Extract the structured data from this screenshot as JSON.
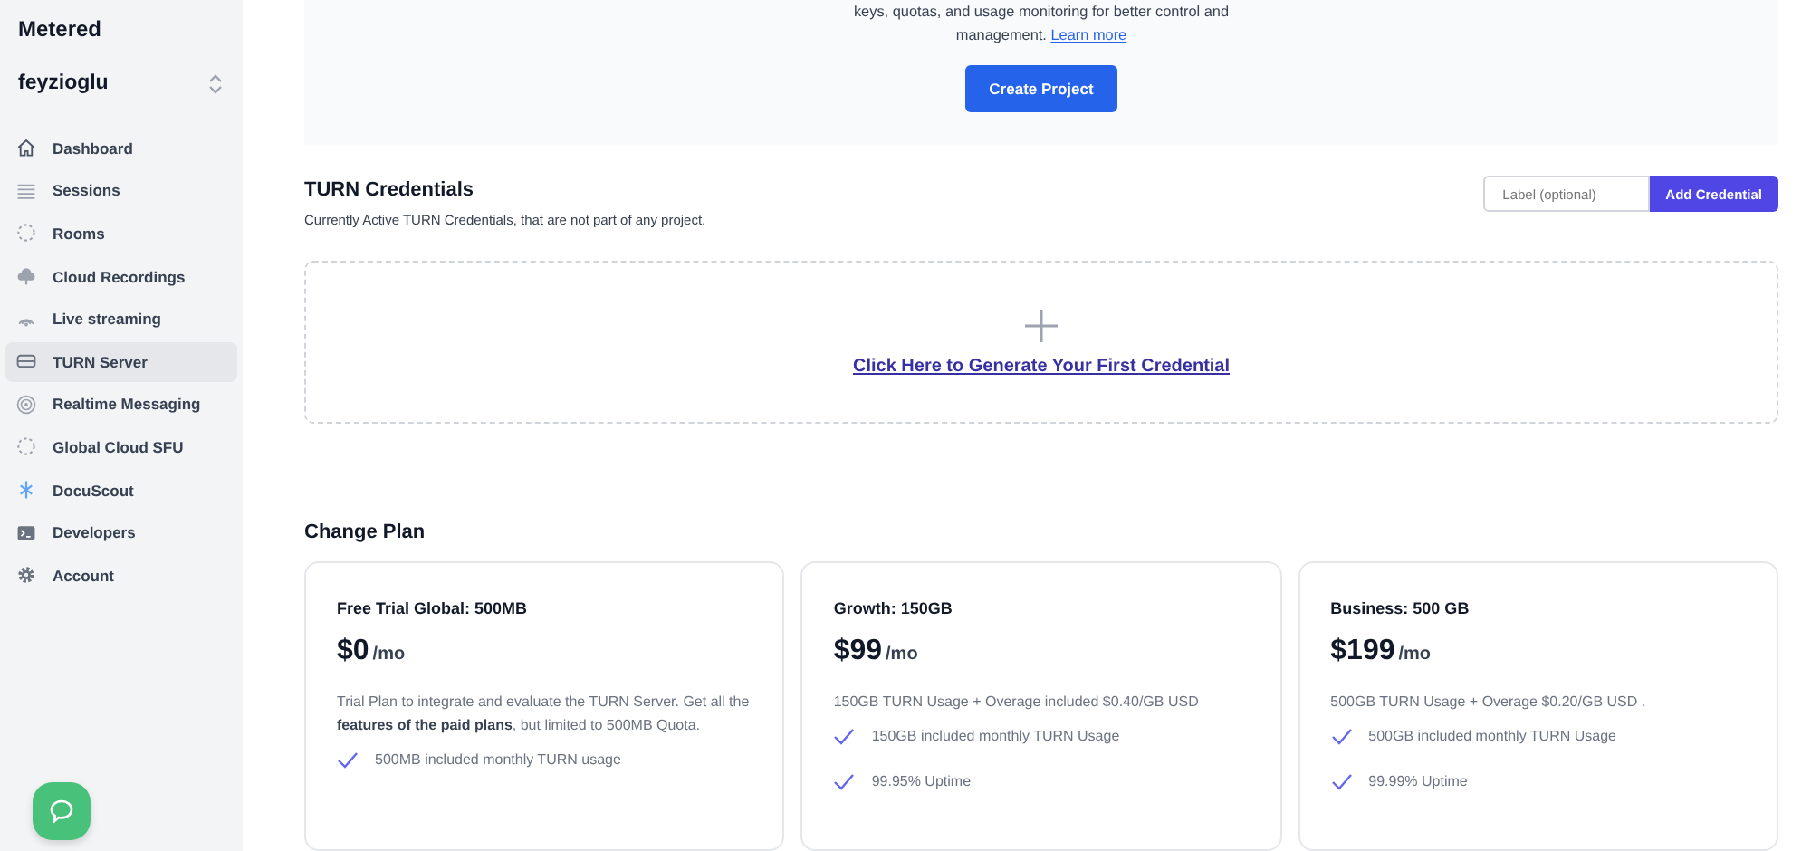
{
  "sidebar": {
    "brand": "Metered",
    "account": "feyzioglu",
    "items": [
      {
        "label": "Dashboard",
        "kind": "home",
        "selected": false
      },
      {
        "label": "Sessions",
        "kind": "list",
        "selected": false
      },
      {
        "label": "Rooms",
        "kind": "dots",
        "selected": false
      },
      {
        "label": "Cloud Recordings",
        "kind": "cloud",
        "selected": false
      },
      {
        "label": "Live streaming",
        "kind": "signal",
        "selected": false
      },
      {
        "label": "TURN Server",
        "kind": "server",
        "selected": true
      },
      {
        "label": "Realtime Messaging",
        "kind": "target",
        "selected": false
      },
      {
        "label": "Global Cloud SFU",
        "kind": "dots",
        "selected": false
      },
      {
        "label": "DocuScout",
        "kind": "tree",
        "selected": false
      },
      {
        "label": "Developers",
        "kind": "terminal",
        "selected": false
      },
      {
        "label": "Account",
        "kind": "gear",
        "selected": false
      }
    ]
  },
  "project_panel": {
    "text": "keys, quotas, and usage monitoring for better control and management.",
    "link": "Learn more",
    "button": "Create Project"
  },
  "credentials": {
    "title": "TURN Credentials",
    "subtitle": "Currently Active TURN Credentials, that are not part of any project.",
    "label_field": {
      "placeholder": "Label (optional)"
    },
    "button": "Add Credential",
    "empty_link": "Click Here to Generate Your First Credential"
  },
  "change_plan": {
    "title": "Change Plan",
    "plans": [
      {
        "name": "Free Trial Global: 500MB",
        "price": "$0",
        "period": "/mo",
        "description": "Trial Plan to integrate and evaluate the TURN Server. Get all the **features of the paid plans**, but limited to 500MB Quota.",
        "features": [
          "500MB included monthly TURN usage"
        ]
      },
      {
        "name": "Growth: 150GB",
        "price": "$99",
        "period": "/mo",
        "description": "150GB TURN Usage + Overage included $0.40/GB USD",
        "features": [
          "150GB included monthly TURN Usage",
          "99.95% Uptime"
        ]
      },
      {
        "name": "Business: 500 GB",
        "price": "$199",
        "period": "/mo",
        "description": "500GB TURN Usage + Overage $0.20/GB USD .",
        "features": [
          "500GB included monthly TURN Usage",
          "99.99% Uptime"
        ]
      }
    ]
  }
}
